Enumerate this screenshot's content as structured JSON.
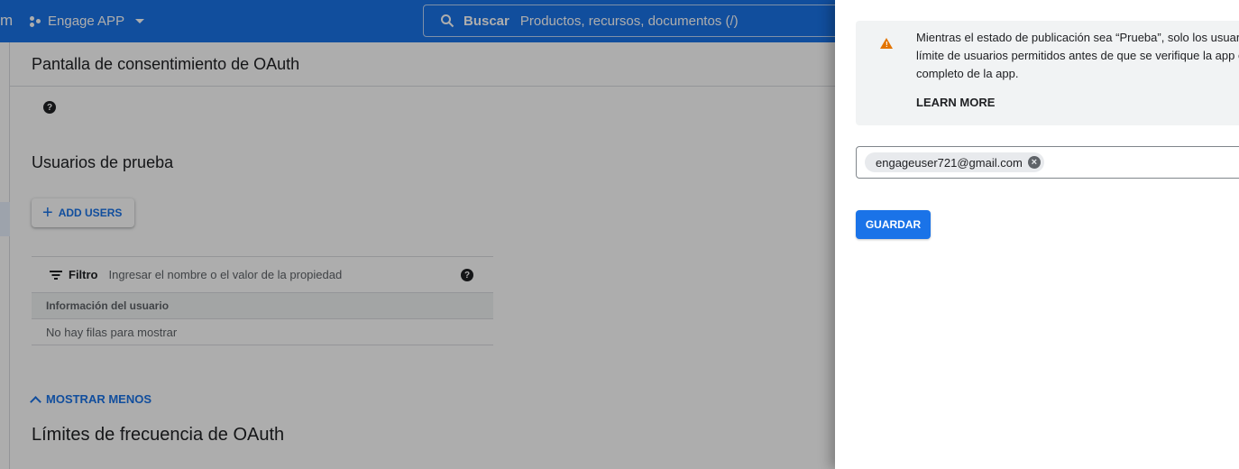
{
  "topbar": {
    "logo_fragment": "m",
    "project_name": "Engage APP",
    "search_label": "Buscar",
    "search_placeholder": "Productos, recursos, documentos (/)"
  },
  "page": {
    "title": "Pantalla de consentimiento de OAuth",
    "test_users_title": "Usuarios de prueba",
    "add_users_label": "ADD USERS",
    "filter_label": "Filtro",
    "filter_placeholder": "Ingresar el nombre o el valor de la propiedad",
    "table_header": "Información del usuario",
    "empty_row": "No hay filas para mostrar",
    "show_less_label": "MOSTRAR MENOS",
    "rate_limits_title": "Límites de frecuencia de OAuth"
  },
  "panel": {
    "notice_lines": [
      "Mientras el estado de publicación sea “Prueba”, solo los usuar",
      "límite de usuarios permitidos antes de que se verifique la app e",
      "completo de la app."
    ],
    "learn_more": "LEARN MORE",
    "emails": [
      "engageuser721@gmail.com"
    ],
    "save_label": "GUARDAR"
  },
  "colors": {
    "primary": "#1a73e8",
    "warning": "#e37400"
  }
}
